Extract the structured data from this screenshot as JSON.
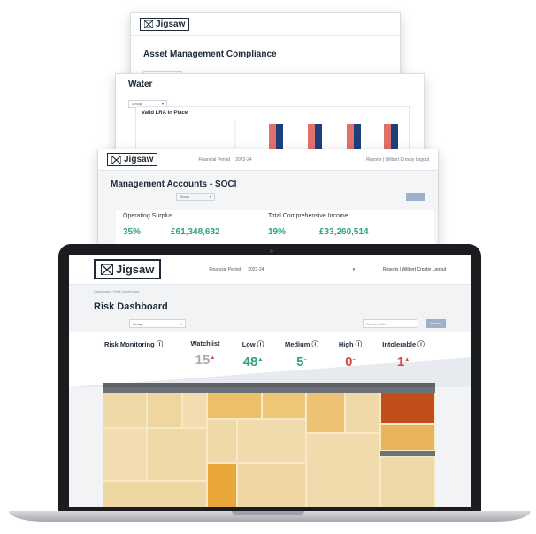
{
  "brand": {
    "name": "Jigsaw"
  },
  "sheets": [
    {
      "title": "Asset Management Compliance",
      "filter_value": "Group"
    },
    {
      "title": "Water",
      "filter_value": "Group",
      "chart_title": "Valid LRA in Place"
    },
    {
      "title": "Management Accounts - SOCI",
      "filter_value": "Group",
      "financial_period_value": "2023-24",
      "kpis": [
        {
          "label": "Operating Surplus",
          "percent": "35%",
          "amount": "£61,348,632"
        },
        {
          "label": "Total Comprehensive Income",
          "percent": "19%",
          "amount": "£33,260,514"
        }
      ]
    }
  ],
  "header": {
    "financial_period_label": "Financial Period",
    "financial_period_value": "2023-24",
    "nav": "Reports | Wilbert Crosby Logout"
  },
  "dashboard": {
    "breadcrumb": "Dashboard / Risk Dashboard",
    "title": "Risk Dashboard",
    "filter_value": "Group",
    "search_placeholder": "Search risks",
    "search_button": "Search",
    "kpis": [
      {
        "label": "Risk Monitoring ⓘ"
      },
      {
        "label": "Watchlist",
        "value": "15",
        "arrow": "▲",
        "color": "#a7adb5"
      },
      {
        "label": "Low ⓘ",
        "value": "48",
        "arrow": "▲",
        "color": "#2fa37a"
      },
      {
        "label": "Medium ⓘ",
        "value": "5",
        "arrow": "–",
        "color": "#2fa37a"
      },
      {
        "label": "High ⓘ",
        "value": "0",
        "arrow": "–",
        "color": "#d64545"
      },
      {
        "label": "Intolerable ⓘ",
        "value": "1",
        "arrow": "▲",
        "color": "#d64545"
      }
    ]
  },
  "colors": {
    "treemap_light": "#f0d9a8",
    "treemap_mid": "#ecc06a",
    "treemap_strong": "#e8a63b",
    "treemap_critical": "#c24e1c",
    "bar_red": "#e0706a",
    "bar_blue": "#1f3f7a"
  }
}
